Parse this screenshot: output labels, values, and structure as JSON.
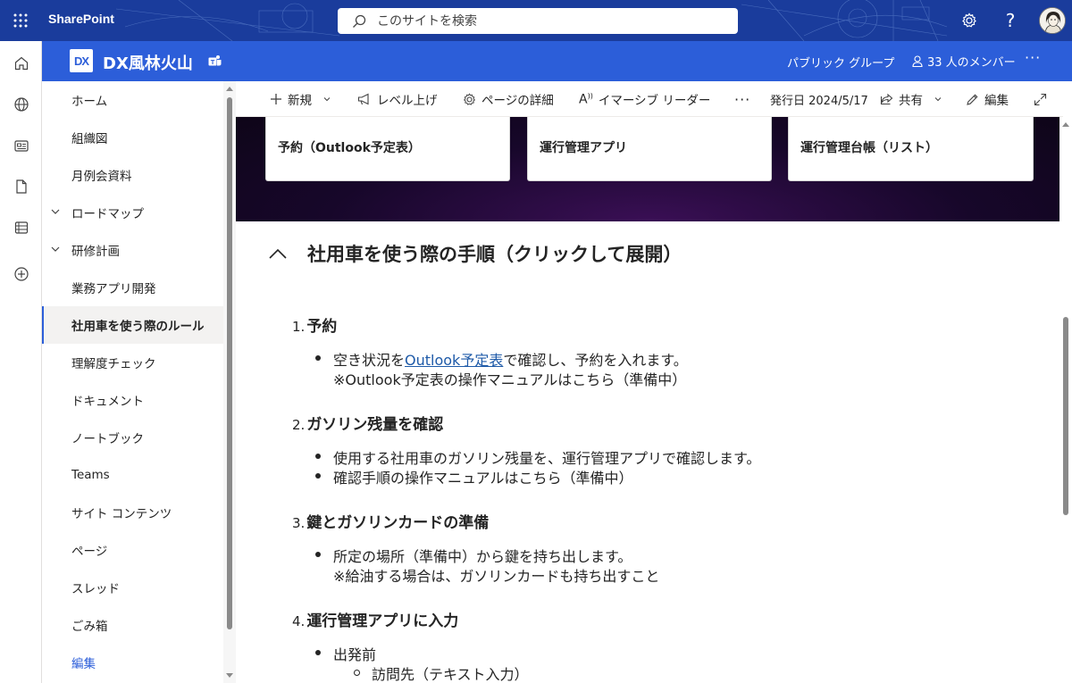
{
  "suitebar": {
    "brand": "SharePoint",
    "search_placeholder": "このサイトを検索"
  },
  "site": {
    "logo_text": "DX",
    "title": "DX風林火山",
    "group_type": "パブリック グループ",
    "members": "33 人のメンバー"
  },
  "nav": {
    "items": [
      {
        "label": "ホーム"
      },
      {
        "label": "組織図"
      },
      {
        "label": "月例会資料"
      },
      {
        "label": "ロードマップ"
      },
      {
        "label": "研修計画"
      },
      {
        "label": "業務アプリ開発"
      },
      {
        "label": "社用車を使う際のルール"
      },
      {
        "label": "理解度チェック"
      },
      {
        "label": "ドキュメント"
      },
      {
        "label": "ノートブック"
      },
      {
        "label": "Teams"
      },
      {
        "label": "サイト コンテンツ"
      },
      {
        "label": "ページ"
      },
      {
        "label": "スレッド"
      },
      {
        "label": "ごみ箱"
      },
      {
        "label": "編集"
      }
    ]
  },
  "commandbar": {
    "new": "新規",
    "level_up": "レベル上げ",
    "page_details": "ページの詳細",
    "immersive": "イマーシブ リーダー",
    "published": "発行日 2024/5/17",
    "share": "共有",
    "edit": "編集"
  },
  "cards": [
    {
      "label": "予約（Outlook予定表）"
    },
    {
      "label": "運行管理アプリ"
    },
    {
      "label": "運行管理台帳（リスト）"
    }
  ],
  "section": {
    "title": "社用車を使う際の手順（クリックして展開）"
  },
  "steps": [
    {
      "num": "1.",
      "heading": "予約",
      "line1_pre": "空き状況を",
      "line1_link": "Outlook予定表",
      "line1_post": "で確認し、予約を入れます。",
      "line2": "※Outlook予定表の操作マニュアルはこちら（準備中）"
    },
    {
      "num": "2.",
      "heading": "ガソリン残量を確認",
      "line1": "使用する社用車のガソリン残量を、運行管理アプリで確認します。",
      "line2": "確認手順の操作マニュアルはこちら（準備中）"
    },
    {
      "num": "3.",
      "heading": "鍵とガソリンカードの準備",
      "line1": "所定の場所（準備中）から鍵を持ち出します。",
      "line2": "※給油する場合は、ガソリンカードも持ち出すこと"
    },
    {
      "num": "4.",
      "heading": "運行管理アプリに入力",
      "line1": "出発前",
      "line2": "訪問先（テキスト入力）"
    }
  ],
  "colors": {
    "suitebar": "#1a3c9c",
    "siteheader": "#2c5ed9",
    "link": "#1e5aa8"
  }
}
